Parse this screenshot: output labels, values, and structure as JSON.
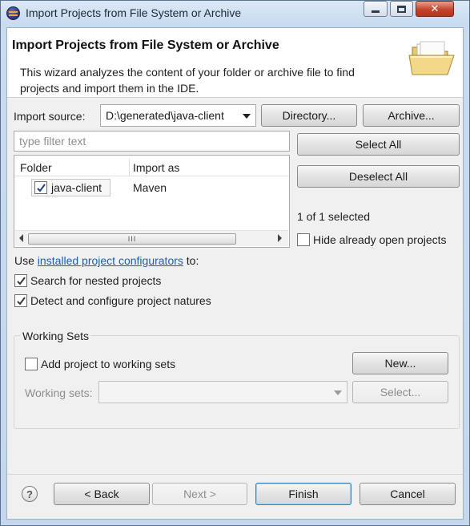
{
  "window": {
    "title": "Import Projects from File System or Archive",
    "close_glyph": "✕"
  },
  "header": {
    "title": "Import Projects from File System or Archive",
    "description": "This wizard analyzes the content of your folder or archive file to find projects and import them in the IDE.",
    "icon": "open-folder-icon"
  },
  "source": {
    "label": "Import source:",
    "value": "D:\\generated\\java-client",
    "directory_button": "Directory...",
    "archive_button": "Archive..."
  },
  "filter": {
    "placeholder": "type filter text"
  },
  "table": {
    "columns": [
      "Folder",
      "Import as"
    ],
    "rows": [
      {
        "folder": "java-client",
        "import_as": "Maven",
        "checked": true
      }
    ],
    "scroll_grip": "III"
  },
  "selection": {
    "select_all": "Select All",
    "deselect_all": "Deselect All",
    "count_text": "1 of 1 selected",
    "hide_open_label": "Hide already open projects",
    "hide_open_checked": false
  },
  "configurators": {
    "prefix": "Use",
    "link": "installed project configurators",
    "suffix": "to:"
  },
  "options": [
    {
      "label": "Search for nested projects",
      "checked": true
    },
    {
      "label": "Detect and configure project natures",
      "checked": true
    }
  ],
  "working_sets": {
    "group_title": "Working Sets",
    "add_label": "Add project to working sets",
    "add_checked": false,
    "new_button": "New...",
    "sets_label": "Working sets:",
    "sets_value": "",
    "select_button": "Select..."
  },
  "footer": {
    "help": "?",
    "back": "< Back",
    "next": "Next >",
    "finish": "Finish",
    "cancel": "Cancel"
  }
}
